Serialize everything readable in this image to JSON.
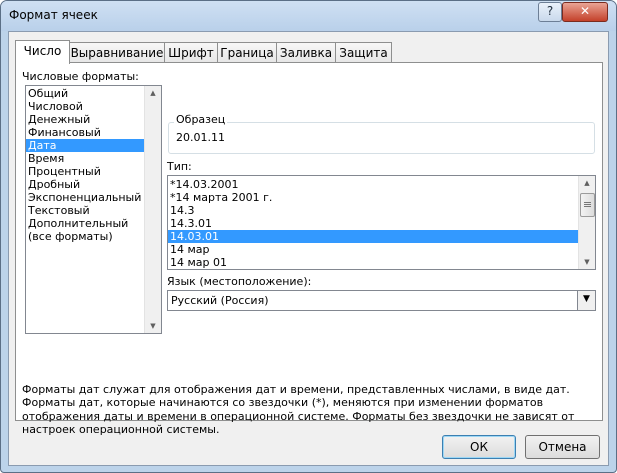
{
  "window": {
    "title": "Формат ячеек",
    "help_label": "?",
    "close_label": "✕"
  },
  "tabs": [
    {
      "label": "Число"
    },
    {
      "label": "Выравнивание"
    },
    {
      "label": "Шрифт"
    },
    {
      "label": "Граница"
    },
    {
      "label": "Заливка"
    },
    {
      "label": "Защита"
    }
  ],
  "category": {
    "label": "Числовые форматы:",
    "items": [
      "Общий",
      "Числовой",
      "Денежный",
      "Финансовый",
      "Дата",
      "Время",
      "Процентный",
      "Дробный",
      "Экспоненциальный",
      "Текстовый",
      "Дополнительный",
      "(все форматы)"
    ],
    "selected": "Дата"
  },
  "sample": {
    "label": "Образец",
    "value": "20.01.11"
  },
  "type_list": {
    "label": "Тип:",
    "items": [
      "*14.03.2001",
      "*14 марта 2001 г.",
      "14.3",
      "14.3.01",
      "14.03.01",
      "14 мар",
      "14 мар 01"
    ],
    "selected": "14.03.01"
  },
  "locale": {
    "label": "Язык (местоположение):",
    "value": "Русский (Россия)"
  },
  "description": "Форматы дат служат для отображения дат и времени, представленных числами, в виде дат. Форматы дат, которые начинаются со звездочки (*), меняются при изменении форматов отображения даты и времени в операционной системе. Форматы без звездочки не зависят от настроек операционной системы.",
  "buttons": {
    "ok": "ОК",
    "cancel": "Отмена"
  },
  "colors": {
    "selection": "#3399ff",
    "title_bg": "#bcd3ea"
  }
}
